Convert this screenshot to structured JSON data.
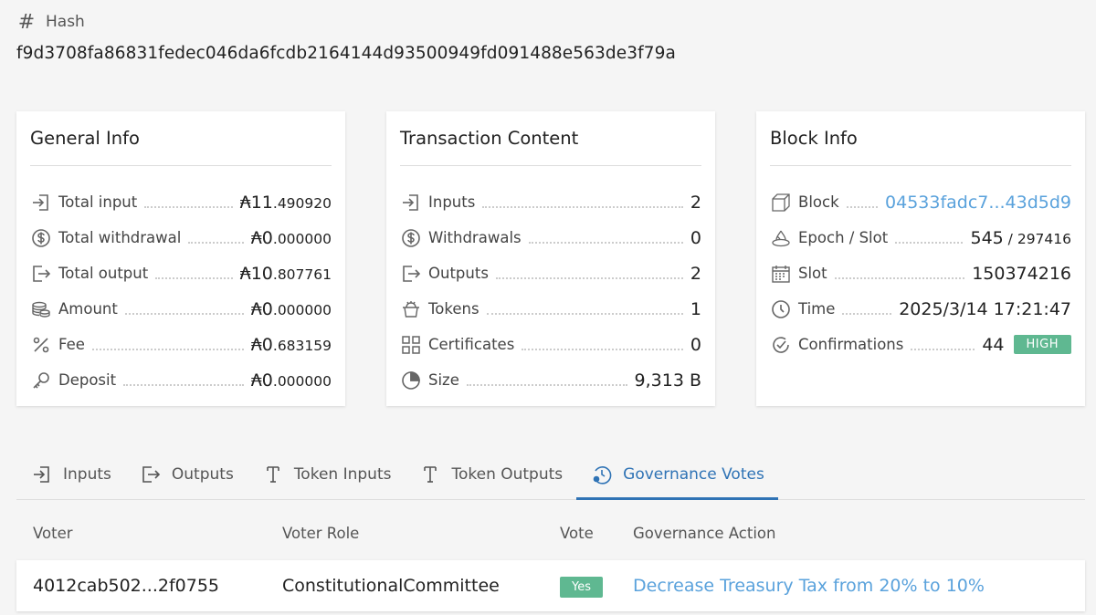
{
  "hash": {
    "label": "Hash",
    "value": "f9d3708fa86831fedec046da6fcdb2164144d93500949fd091488e563de3f79a"
  },
  "general_info": {
    "title": "General Info",
    "currency_symbol": "₳",
    "rows": [
      {
        "icon": "input-icon",
        "label": "Total input",
        "int": "11",
        "dec": ".490920"
      },
      {
        "icon": "dollar-circle-icon",
        "label": "Total withdrawal",
        "int": "0",
        "dec": ".000000"
      },
      {
        "icon": "output-icon",
        "label": "Total output",
        "int": "10",
        "dec": ".807761"
      },
      {
        "icon": "coins-icon",
        "label": "Amount",
        "int": "0",
        "dec": ".000000"
      },
      {
        "icon": "percent-icon",
        "label": "Fee",
        "int": "0",
        "dec": ".683159"
      },
      {
        "icon": "key-icon",
        "label": "Deposit",
        "int": "0",
        "dec": ".000000"
      }
    ]
  },
  "transaction_content": {
    "title": "Transaction Content",
    "rows": [
      {
        "icon": "input-icon",
        "label": "Inputs",
        "value": "2"
      },
      {
        "icon": "dollar-circle-icon",
        "label": "Withdrawals",
        "value": "0"
      },
      {
        "icon": "output-icon",
        "label": "Outputs",
        "value": "2"
      },
      {
        "icon": "tokens-icon",
        "label": "Tokens",
        "value": "1"
      },
      {
        "icon": "grid-icon",
        "label": "Certificates",
        "value": "0"
      },
      {
        "icon": "pie-icon",
        "label": "Size",
        "value": "9,313 B"
      }
    ]
  },
  "block_info": {
    "title": "Block Info",
    "block_label": "Block",
    "block_value": "04533fadc7...43d5d9",
    "epoch_label": "Epoch / Slot",
    "epoch_value": "545",
    "epoch_slot": " / 297416",
    "slot_label": "Slot",
    "slot_value": "150374216",
    "time_label": "Time",
    "time_value": "2025/3/14 17:21:47",
    "confirmations_label": "Confirmations",
    "confirmations_value": "44",
    "confirmations_badge": "HIGH"
  },
  "tabs": [
    {
      "icon": "input-icon",
      "label": "Inputs"
    },
    {
      "icon": "output-icon",
      "label": "Outputs"
    },
    {
      "icon": "token-t-icon",
      "label": "Token Inputs"
    },
    {
      "icon": "token-t-icon",
      "label": "Token Outputs"
    },
    {
      "icon": "governance-icon",
      "label": "Governance Votes",
      "active": true
    }
  ],
  "votes_table": {
    "headers": {
      "voter": "Voter",
      "role": "Voter Role",
      "vote": "Vote",
      "action": "Governance Action"
    },
    "rows": [
      {
        "voter": "4012cab502...2f0755",
        "role": "ConstitutionalCommittee",
        "vote": "Yes",
        "action": "Decrease Treasury Tax from 20% to 10%"
      }
    ]
  },
  "colors": {
    "accent_blue": "#2f73b5",
    "link_blue": "#5aa2dc",
    "badge_green": "#5fb891"
  }
}
